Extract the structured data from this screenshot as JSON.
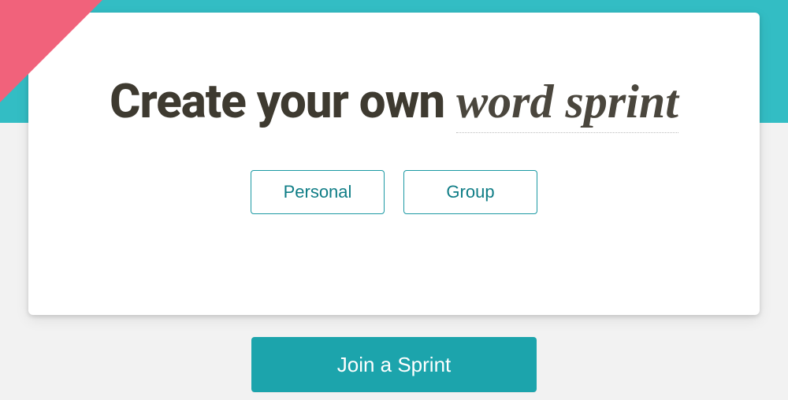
{
  "heading": {
    "prefix": "Create your own",
    "emphasis": "word sprint"
  },
  "options": {
    "personal": "Personal",
    "group": "Group"
  },
  "cta": {
    "join": "Join a Sprint"
  }
}
